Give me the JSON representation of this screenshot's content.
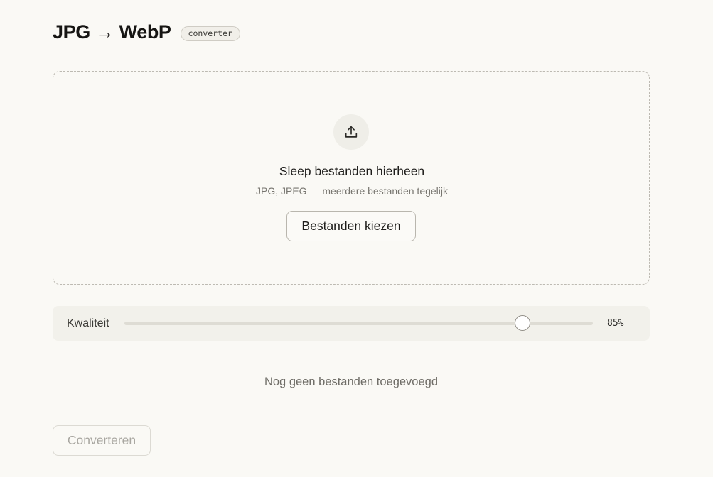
{
  "header": {
    "title": "JPG → WebP",
    "badge": "converter"
  },
  "dropzone": {
    "icon": "upload-icon",
    "title": "Sleep bestanden hierheen",
    "subtitle": "JPG, JPEG — meerdere bestanden tegelijk",
    "choose_label": "Bestanden kiezen"
  },
  "quality": {
    "label": "Kwaliteit",
    "value": 85,
    "value_text": "85%"
  },
  "files": {
    "empty_text": "Nog geen bestanden toegevoegd"
  },
  "actions": {
    "convert_label": "Converteren",
    "convert_disabled": true
  }
}
